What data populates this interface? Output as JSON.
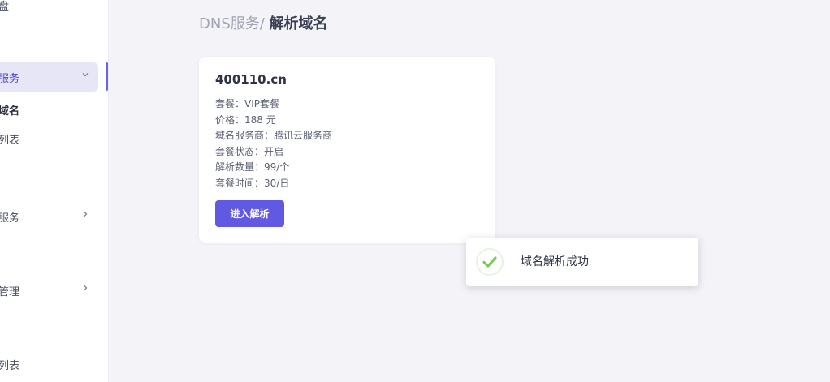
{
  "sidebar": {
    "items": [
      {
        "label": "盘"
      },
      {
        "label": "服务",
        "chevron": "chevron-down-icon"
      },
      {
        "label": "域名"
      },
      {
        "label": "列表"
      },
      {
        "label": "服务",
        "chevron": "chevron-right-icon"
      },
      {
        "label": "管理",
        "chevron": "chevron-right-icon"
      },
      {
        "label": "列表"
      }
    ]
  },
  "breadcrumb": {
    "parent": "DNS服务/",
    "current": "解析域名"
  },
  "card": {
    "domain": "400110.cn",
    "details": [
      "套餐：VIP套餐",
      "价格：188 元",
      "域名服务商：腾讯云服务商",
      "套餐状态：开启",
      "解析数量：99/个",
      "套餐时间：30/日"
    ],
    "button_label": "进入解析"
  },
  "toast": {
    "message": "域名解析成功",
    "icon": "check-icon"
  },
  "colors": {
    "accent": "#6159e3",
    "success": "#7ecb5a"
  }
}
